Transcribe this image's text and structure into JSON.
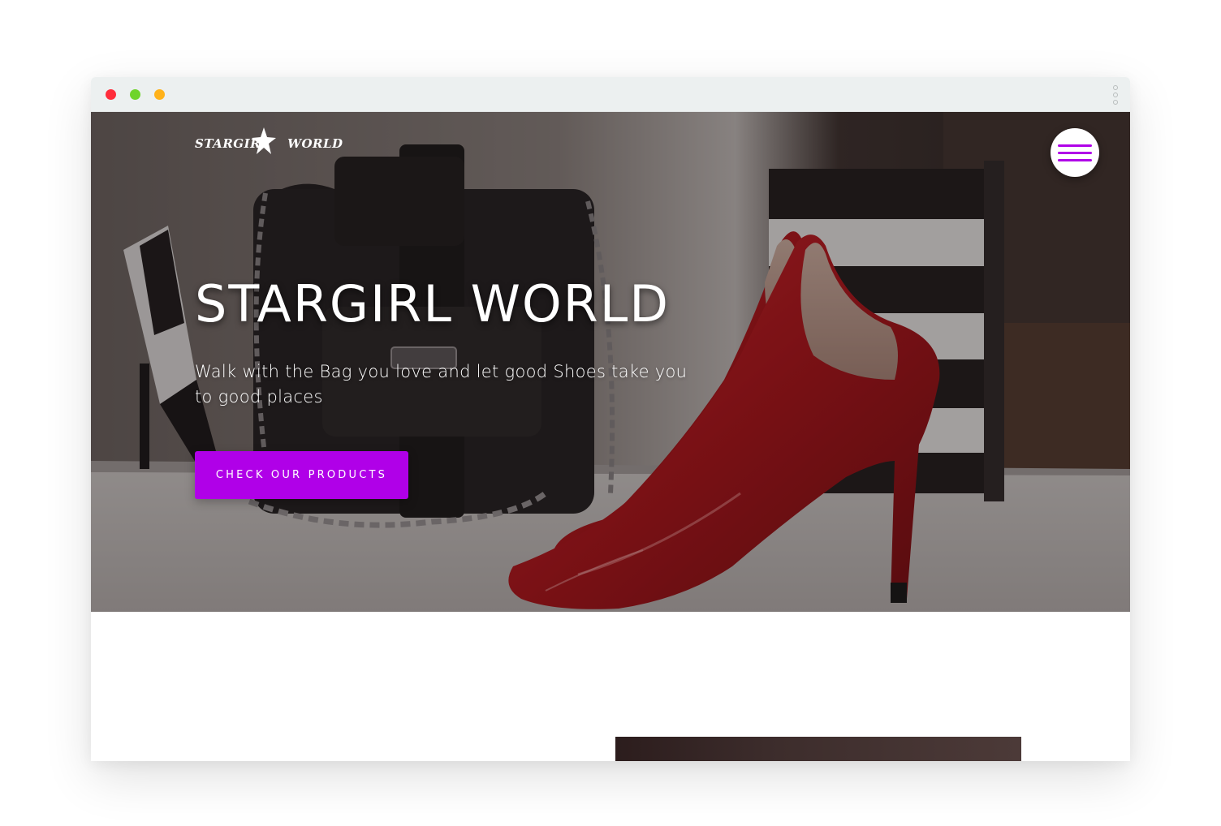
{
  "browser": {
    "traffic_lights": {
      "close": "#ff2d3b",
      "minimize": "#6fd42b",
      "zoom": "#ffb21a"
    },
    "menu_icon": "vertical-dots-icon"
  },
  "header": {
    "logo": {
      "word1": "STARGIRL",
      "word2": "WORLD",
      "icon": "star-icon"
    },
    "menu_icon": "hamburger-icon",
    "accent_color": "#b000e8"
  },
  "hero": {
    "title": "STARGIRL WORLD",
    "subtitle": "Walk with the Bag you love and let good Shoes take you to good places",
    "cta_label": "CHECK OUR PRODUCTS"
  }
}
